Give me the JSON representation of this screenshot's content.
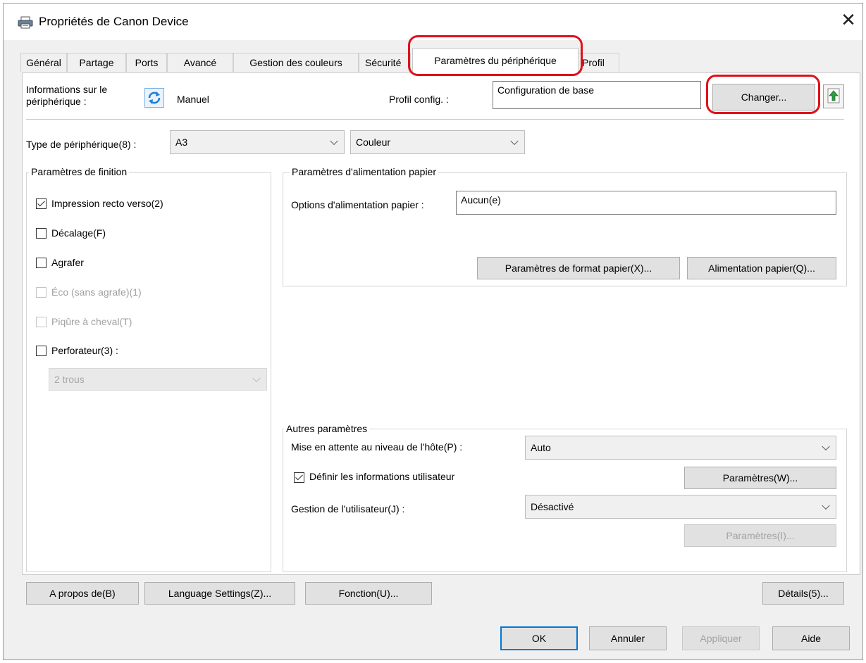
{
  "window": {
    "title": "Propriétés de Canon Device"
  },
  "tabs": [
    {
      "label": "Général"
    },
    {
      "label": "Partage"
    },
    {
      "label": "Ports"
    },
    {
      "label": "Avancé"
    },
    {
      "label": "Gestion des couleurs"
    },
    {
      "label": "Sécurité"
    },
    {
      "label": "Paramètres du périphérique",
      "active": true
    },
    {
      "label": "Profil"
    }
  ],
  "device_info": {
    "label_line1": "Informations sur le",
    "label_line2": "périphérique :",
    "mode": "Manuel",
    "profile_label": "Profil config. :",
    "profile_value": "Configuration de base",
    "change_button": "Changer..."
  },
  "device_type": {
    "label": "Type de périphérique(8) :",
    "format": "A3",
    "color": "Couleur"
  },
  "finishing": {
    "title": "Paramètres de finition",
    "items": [
      {
        "label": "Impression recto verso(2)",
        "checked": true,
        "disabled": false
      },
      {
        "label": "Décalage(F)",
        "checked": false,
        "disabled": false
      },
      {
        "label": "Agrafer",
        "checked": false,
        "disabled": false
      },
      {
        "label": "Éco (sans agrafe)(1)",
        "checked": false,
        "disabled": true
      },
      {
        "label": "Piqûre à cheval(T)",
        "checked": false,
        "disabled": true
      },
      {
        "label": "Perforateur(3) :",
        "checked": false,
        "disabled": false
      }
    ],
    "punch_value": "2 trous"
  },
  "paper_feed": {
    "title": "Paramètres d'alimentation papier",
    "options_label": "Options d'alimentation papier :",
    "options_value": "Aucun(e)",
    "format_button": "Paramètres de format papier(X)...",
    "feed_button": "Alimentation papier(Q)..."
  },
  "other": {
    "title": "Autres paramètres",
    "spool_label": "Mise en attente au niveau de l'hôte(P) :",
    "spool_value": "Auto",
    "user_info_label": "Définir les informations utilisateur",
    "user_info_checked": true,
    "params_w_button": "Paramètres(W)...",
    "user_mgmt_label": "Gestion de l'utilisateur(J) :",
    "user_mgmt_value": "Désactivé",
    "params_i_button": "Paramètres(I)..."
  },
  "bottom_buttons": {
    "about": "A propos de(B)",
    "language": "Language Settings(Z)...",
    "function": "Fonction(U)...",
    "details": "Détails(5)..."
  },
  "dialog_buttons": {
    "ok": "OK",
    "cancel": "Annuler",
    "apply": "Appliquer",
    "help": "Aide"
  },
  "colors": {
    "highlight": "#e0101a",
    "default_button_border": "#0078d7",
    "sync_icon": "#1e7fd8"
  }
}
